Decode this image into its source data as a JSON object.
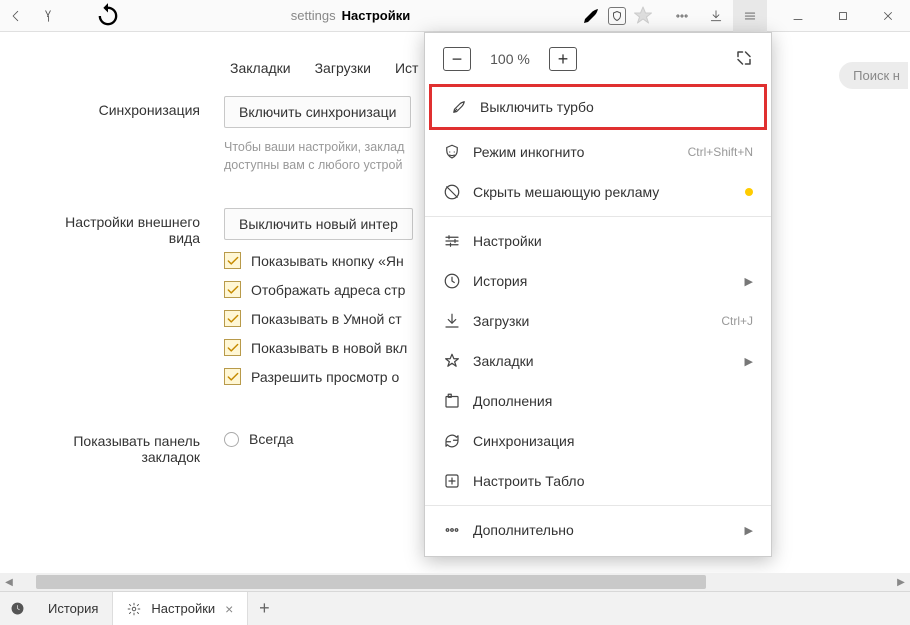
{
  "toolbar": {
    "address_prefix": "settings",
    "address_title": "Настройки"
  },
  "nav": {
    "tab1": "Закладки",
    "tab2": "Загрузки",
    "tab3": "Ист"
  },
  "search_placeholder": "Поиск н",
  "sync": {
    "heading": "Синхронизация",
    "button": "Включить синхронизаци",
    "hint1": "Чтобы ваши настройки, заклад",
    "hint2": "доступны вам с любого устрой"
  },
  "appearance": {
    "heading": "Настройки внешнего вида",
    "button": "Выключить новый интер",
    "chk1": "Показывать кнопку «Ян",
    "chk2": "Отображать адреса стр",
    "chk3": "Показывать в Умной ст",
    "chk4": "Показывать в новой вкл",
    "chk5": "Разрешить просмотр о"
  },
  "bookmarksbar": {
    "heading": "Показывать панель закладок",
    "opt1": "Всегда"
  },
  "menu": {
    "zoom_value": "100 %",
    "turbo": "Выключить турбо",
    "incognito": "Режим инкогнито",
    "incognito_shortcut": "Ctrl+Shift+N",
    "hide_ads": "Скрыть мешающую рекламу",
    "settings": "Настройки",
    "history": "История",
    "downloads": "Загрузки",
    "downloads_shortcut": "Ctrl+J",
    "bookmarks": "Закладки",
    "extensions": "Дополнения",
    "syncmenu": "Синхронизация",
    "tableau": "Настроить Табло",
    "more": "Дополнительно"
  },
  "bottom": {
    "history_tab": "История",
    "settings_tab": "Настройки"
  }
}
